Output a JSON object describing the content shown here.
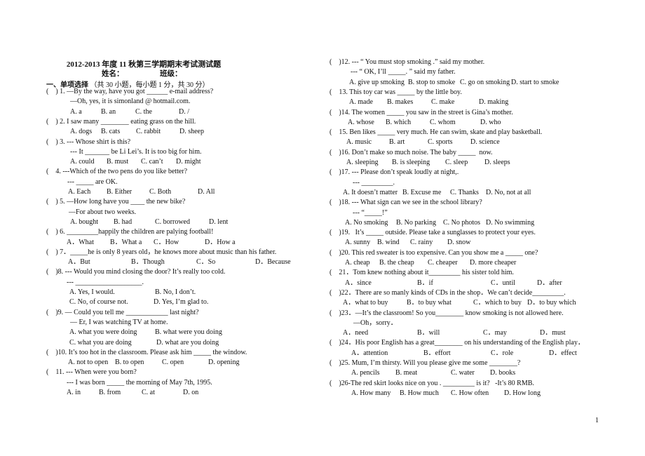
{
  "title": "2012-2013 年度 11 秋第三学期期末考试测试题",
  "name_label": "姓名：",
  "class_label": "班级：",
  "section_heading": "一、单项选择",
  "section_note": "（共 30 小题，每小题 1 分，共 30 分）",
  "page_number": "1",
  "left": {
    "lines": [
      "(    ) 1. —By the way, have you got ______ e-mail address?",
      "—Oh, yes, it is simonland @ hotmail.com.",
      [
        "A. a",
        "B. an",
        "C. the",
        "D. /"
      ],
      "(    ) 2. I saw many ________ eating grass on the hill.",
      [
        "A. dogs",
        "B. cats",
        "C. rabbit",
        "D. sheep"
      ],
      "(    ) 3. --- Whose shirt is this?",
      "--- It _______ be Li Lei’s. It is too big for him.",
      [
        "A. could",
        "B. must",
        "C. can’t",
        "D. might"
      ],
      "(    4. ---Which of the two pens do you like better?",
      "--- _____ are OK.",
      [
        "A. Each",
        "B. Either",
        "C. Both",
        "D. All"
      ],
      "(    ) 5. —How long have you ____ the new bike?",
      "—For about two weeks.",
      [
        "A. bought",
        "B. had",
        "C. borrowed",
        "D. lent"
      ],
      "(    ) 6. _________happily the children are palying football!",
      [
        "A．What",
        "B．What a",
        "C．How",
        "D．How a"
      ],
      "(    ) 7．_____he is only 8 years old，he knows more about music than his father.",
      [
        "A．But",
        "B．Though",
        "C．So",
        "D．Because"
      ],
      "(    )8. --- Would you mind closing the door? It’s really too cold.",
      "--- ___________________.",
      [
        "A. Yes, I would.",
        "B. No, I don’t."
      ],
      [
        "C. No, of course not.",
        "D. Yes, I’m glad to."
      ],
      "(    )9. — Could you tell me ____________ last night?",
      "— Er, I was watching TV at home.",
      [
        "A. what you were doing",
        "B. what were you doing"
      ],
      [
        "C. what you are doing",
        "D. what are you doing"
      ],
      "(    )10. It’s too hot in the classroom. Please ask him _____ the window.",
      [
        "A. not to open",
        "B. to open",
        "C. open",
        "D. opening"
      ],
      "(    11. --- When were you born?",
      "--- I was born _____ the morning of May 7th, 1995.",
      [
        "A. in",
        "B. from",
        "C. at",
        "D. on"
      ]
    ]
  },
  "right": {
    "lines": [
      "(    )12. --- “ You must stop smoking .” said my mother.",
      "--- “ OK, I’ll _____. ” said my father.",
      [
        "A. give up smoking",
        "B. stop to smoke",
        "C. go on smoking",
        "D. start to smoke"
      ],
      "(    13. This toy car was _____ by the little boy.",
      [
        "A. made",
        "B. makes",
        "C. make",
        "D. making"
      ],
      "(    )14. The women _____ you saw in the street is Gina’s mother.",
      [
        "A. whose",
        "B. which",
        "C. whom",
        "D. who"
      ],
      "(    15. Ben likes _____ very much. He can swim, skate and play basketball.",
      [
        "A. music",
        "B. art",
        "C. sports",
        "D. science"
      ],
      "(    )16. Don’t make so much noise. The baby _____  now.",
      [
        "A. sleeping",
        "B. is sleeping",
        "C. sleep",
        "D. sleeps"
      ],
      "(    )17. --- Please don’t speak loudly at night,.",
      "--- _________.",
      [
        "A. It doesn’t matter",
        "B. Excuse me",
        "C. Thanks",
        "D. No, not at all"
      ],
      "(    )18. --- What sign can we see in the school library?",
      "--- “_____!”",
      [
        "A. No smoking",
        "B. No parking",
        "C. No photos",
        "D. No swimming"
      ],
      "(    )19.   It’s _____ outside. Please take a sunglasses to protect your eyes.",
      [
        "A. sunny",
        "B. wind",
        "C. rainy",
        "D. snow"
      ],
      "(    )20. This red sweater is too expensive. Can you show me a _____ one?",
      [
        "A. cheap",
        "B. the cheap",
        "C. cheaper",
        "D. more cheaper"
      ],
      "(    21．Tom knew nothing about it_________ his sister told him.",
      [
        "A．since",
        "B．if",
        "C．until",
        "D．after"
      ],
      "(    )22．There are so manly kinds of CDs in the shop．We can’t decide_________.",
      [
        "A．what to buy",
        "B．to buy what",
        "C．which to buy",
        "D．to buy which"
      ],
      "(    )23．—It’s the classroom! So you________ know smoking is not allowed here.",
      "—Oh，sorry．",
      [
        "A．need",
        "B．will",
        "C．may",
        "D．must"
      ],
      "(    )24．His poor English has a great________ on his understanding of the English play．",
      [
        "A．attention",
        "B．effort",
        "C．role",
        "D．effect"
      ],
      "(    )25. Mum, I’m thirsty. Will you please give me some ________?",
      [
        "A. pencils",
        "B. meat",
        "C. water",
        "D. books"
      ],
      "(    )26-The red skirt looks nice on you . _________ is it?   -It’s 80 RMB.",
      [
        "A. How many",
        "B. How much",
        "C. How often",
        "D. How long"
      ]
    ]
  }
}
